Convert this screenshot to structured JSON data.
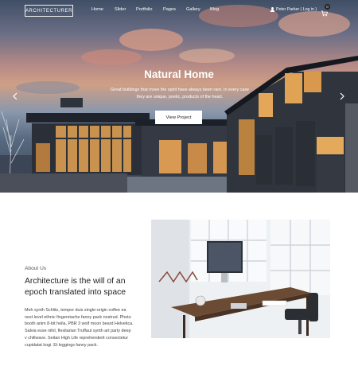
{
  "header": {
    "logo": "ARCHITECTURER",
    "nav": [
      "Home",
      "Slider",
      "Portfolio",
      "Pages",
      "Gallery",
      "Blog"
    ],
    "user_link": "Peter Parker ( Log in )",
    "cart_count": "0"
  },
  "hero": {
    "title": "Natural Home",
    "subtitle": "Great buildings that move the spirit have always been rare. In every case they are unique, poetic, products of the heart.",
    "button": "View Project"
  },
  "about": {
    "label": "About Us",
    "heading": "Architecture is the will of an epoch translated into space",
    "text": "Meh synth Schlitz, tempor duis single-origin coffee ea next level ethnic fingerstache fanny pack nostrud. Photo booth anim 8-bit hella, PBR 3 wolf moon beard Helvetica. Salvia esse nihil, flexitarian Truffaut synth art party deep v chillwave. Seitan High Life reprehenderit consectetur cupidatat kogi. Et leggings fanny pack."
  },
  "icons": {
    "user": "user-icon",
    "cart": "cart-icon",
    "prev": "chevron-left-icon",
    "next": "chevron-right-icon"
  }
}
